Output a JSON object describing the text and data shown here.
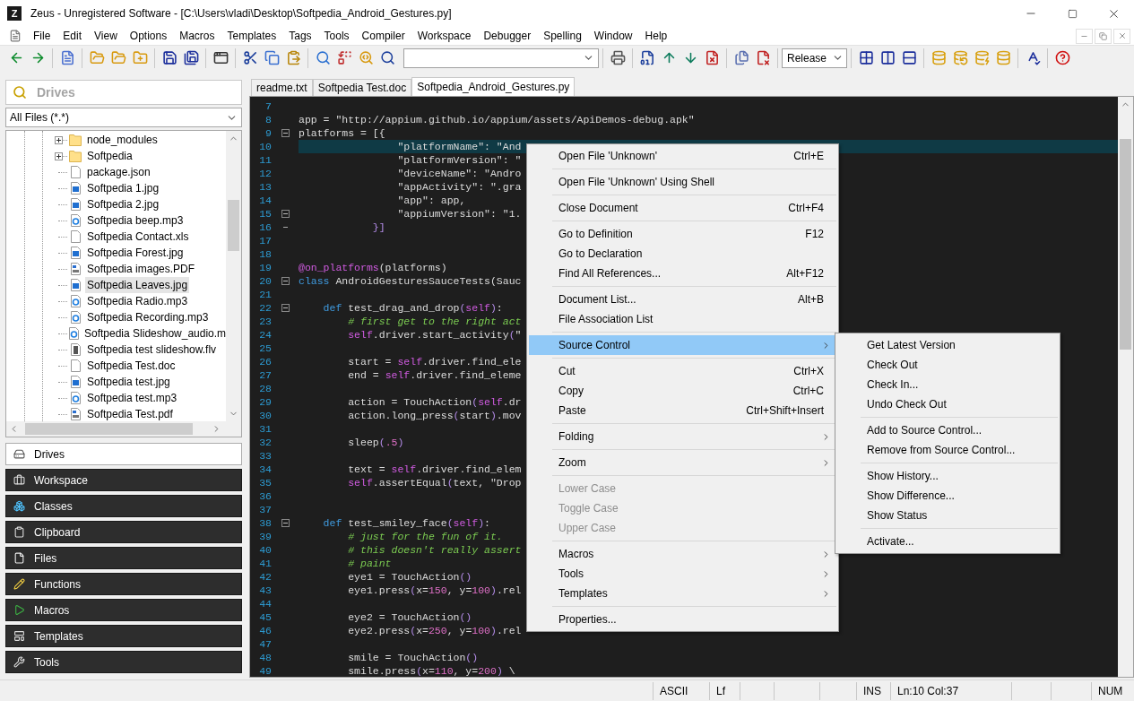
{
  "window": {
    "app_icon_letter": "Z",
    "title": "Zeus - Unregistered Software - [C:\\Users\\vladi\\Desktop\\Softpedia_Android_Gestures.py]"
  },
  "menu_bar": [
    "File",
    "Edit",
    "View",
    "Options",
    "Macros",
    "Templates",
    "Tags",
    "Tools",
    "Compiler",
    "Workspace",
    "Debugger",
    "Spelling",
    "Window",
    "Help"
  ],
  "toolbar": {
    "configuration": "Release"
  },
  "side_panel": {
    "header": "Drives",
    "filter": "All Files (*.*)",
    "tree": [
      {
        "name": "node_modules",
        "kind": "folder",
        "expanded": false,
        "selected": false
      },
      {
        "name": "Softpedia",
        "kind": "folder",
        "expanded": false,
        "selected": false
      },
      {
        "name": "package.json",
        "kind": "file",
        "selected": false
      },
      {
        "name": "Softpedia 1.jpg",
        "kind": "image",
        "selected": false
      },
      {
        "name": "Softpedia 2.jpg",
        "kind": "image",
        "selected": false
      },
      {
        "name": "Softpedia beep.mp3",
        "kind": "audio",
        "selected": false
      },
      {
        "name": "Softpedia Contact.xls",
        "kind": "file",
        "selected": false
      },
      {
        "name": "Softpedia Forest.jpg",
        "kind": "image",
        "selected": false
      },
      {
        "name": "Softpedia images.PDF",
        "kind": "pdf",
        "selected": false
      },
      {
        "name": "Softpedia Leaves.jpg",
        "kind": "image",
        "selected": true
      },
      {
        "name": "Softpedia Radio.mp3",
        "kind": "audio",
        "selected": false
      },
      {
        "name": "Softpedia Recording.mp3",
        "kind": "audio",
        "selected": false
      },
      {
        "name": "Softpedia Slideshow_audio.m",
        "kind": "audio",
        "selected": false
      },
      {
        "name": "Softpedia test slideshow.flv",
        "kind": "video",
        "selected": false
      },
      {
        "name": "Softpedia Test.doc",
        "kind": "file",
        "selected": false
      },
      {
        "name": "Softpedia test.jpg",
        "kind": "image",
        "selected": false
      },
      {
        "name": "Softpedia test.mp3",
        "kind": "audio",
        "selected": false
      },
      {
        "name": "Softpedia Test.pdf",
        "kind": "pdf",
        "selected": false
      }
    ],
    "panels": [
      {
        "label": "Drives",
        "kind": "drives",
        "selected": true
      },
      {
        "label": "Workspace",
        "kind": "workspace",
        "selected": false
      },
      {
        "label": "Classes",
        "kind": "classes",
        "selected": false
      },
      {
        "label": "Clipboard",
        "kind": "clipboard",
        "selected": false
      },
      {
        "label": "Files",
        "kind": "files",
        "selected": false
      },
      {
        "label": "Functions",
        "kind": "functions",
        "selected": false
      },
      {
        "label": "Macros",
        "kind": "macros",
        "selected": false
      },
      {
        "label": "Templates",
        "kind": "templates",
        "selected": false
      },
      {
        "label": "Tools",
        "kind": "tools",
        "selected": false
      }
    ]
  },
  "editor": {
    "tabs": [
      {
        "label": "readme.txt",
        "selected": false
      },
      {
        "label": "Softpedia Test.doc",
        "selected": false
      },
      {
        "label": "Softpedia_Android_Gestures.py",
        "selected": true
      }
    ],
    "lines": [
      {
        "number": "7",
        "current": false
      },
      {
        "number": "8",
        "current": false,
        "tokens": [
          {
            "kind": "plain",
            "text": "app = \"http://appium.github.io/appium/assets/ApiDemos-debug.apk\""
          }
        ]
      },
      {
        "number": "9",
        "current": false,
        "fold": {
          "kind": "start"
        },
        "tokens": [
          {
            "kind": "plain",
            "text": "platforms = [{"
          }
        ]
      },
      {
        "number": "10",
        "current": true,
        "tokens": [
          {
            "kind": "plain",
            "text": "                \"platformName\": \"And"
          }
        ]
      },
      {
        "number": "11",
        "current": false,
        "tokens": [
          {
            "kind": "plain",
            "text": "                \"platformVersion\": \""
          }
        ]
      },
      {
        "number": "12",
        "current": false,
        "tokens": [
          {
            "kind": "plain",
            "text": "                \"deviceName\": \"Andro"
          }
        ]
      },
      {
        "number": "13",
        "current": false,
        "tokens": [
          {
            "kind": "plain",
            "text": "                \"appActivity\": \".gra"
          }
        ]
      },
      {
        "number": "14",
        "current": false,
        "tokens": [
          {
            "kind": "plain",
            "text": "                \"app\": app,"
          }
        ]
      },
      {
        "number": "15",
        "current": false,
        "fold": {
          "kind": "start"
        },
        "tokens": [
          {
            "kind": "plain",
            "text": "                \"appiumVersion\": \"1."
          }
        ]
      },
      {
        "number": "16",
        "current": false,
        "fold": {
          "kind": "end"
        },
        "tokens": [
          {
            "kind": "paren",
            "text": "            }]"
          }
        ]
      },
      {
        "number": "17",
        "current": false
      },
      {
        "number": "18",
        "current": false
      },
      {
        "number": "19",
        "current": false,
        "tokens": [
          {
            "kind": "deco",
            "text": "@on_platforms"
          },
          {
            "kind": "plain",
            "text": "(platforms)"
          }
        ]
      },
      {
        "number": "20",
        "current": false,
        "fold": {
          "kind": "start"
        },
        "tokens": [
          {
            "kind": "kw",
            "text": "class"
          },
          {
            "kind": "plain",
            "text": " AndroidGesturesSauceTests(Sauc"
          }
        ]
      },
      {
        "number": "21",
        "current": false
      },
      {
        "number": "22",
        "current": false,
        "fold": {
          "kind": "start"
        },
        "tokens": [
          {
            "kind": "kw",
            "text": "    def"
          },
          {
            "kind": "plain",
            "text": " test_drag_and_drop"
          },
          {
            "kind": "paren",
            "text": "("
          },
          {
            "kind": "self",
            "text": "self"
          },
          {
            "kind": "paren",
            "text": ")"
          },
          {
            "kind": "plain",
            "text": ":"
          }
        ]
      },
      {
        "number": "23",
        "current": false,
        "tokens": [
          {
            "kind": "comment",
            "text": "        # first get to the right act"
          }
        ]
      },
      {
        "number": "24",
        "current": false,
        "tokens": [
          {
            "kind": "self",
            "text": "        self"
          },
          {
            "kind": "plain",
            "text": ".driver.start_activity"
          },
          {
            "kind": "paren",
            "text": "("
          },
          {
            "kind": "plain",
            "text": "\""
          }
        ]
      },
      {
        "number": "25",
        "current": false
      },
      {
        "number": "26",
        "current": false,
        "tokens": [
          {
            "kind": "plain",
            "text": "        start = "
          },
          {
            "kind": "self",
            "text": "self"
          },
          {
            "kind": "plain",
            "text": ".driver.find_ele"
          }
        ]
      },
      {
        "number": "27",
        "current": false,
        "tokens": [
          {
            "kind": "plain",
            "text": "        end = "
          },
          {
            "kind": "self",
            "text": "self"
          },
          {
            "kind": "plain",
            "text": ".driver.find_eleme"
          }
        ]
      },
      {
        "number": "28",
        "current": false
      },
      {
        "number": "29",
        "current": false,
        "tokens": [
          {
            "kind": "plain",
            "text": "        action = TouchAction"
          },
          {
            "kind": "paren",
            "text": "("
          },
          {
            "kind": "self",
            "text": "self"
          },
          {
            "kind": "plain",
            "text": ".dr"
          }
        ]
      },
      {
        "number": "30",
        "current": false,
        "tokens": [
          {
            "kind": "plain",
            "text": "        action.long_press"
          },
          {
            "kind": "paren",
            "text": "("
          },
          {
            "kind": "plain",
            "text": "start"
          },
          {
            "kind": "paren",
            "text": ")"
          },
          {
            "kind": "plain",
            "text": ".mov"
          }
        ]
      },
      {
        "number": "31",
        "current": false
      },
      {
        "number": "32",
        "current": false,
        "tokens": [
          {
            "kind": "plain",
            "text": "        sleep"
          },
          {
            "kind": "paren",
            "text": "("
          },
          {
            "kind": "num",
            "text": ".5"
          },
          {
            "kind": "paren",
            "text": ")"
          }
        ]
      },
      {
        "number": "33",
        "current": false
      },
      {
        "number": "34",
        "current": false,
        "tokens": [
          {
            "kind": "plain",
            "text": "        text = "
          },
          {
            "kind": "self",
            "text": "self"
          },
          {
            "kind": "plain",
            "text": ".driver.find_elem"
          }
        ]
      },
      {
        "number": "35",
        "current": false,
        "tokens": [
          {
            "kind": "self",
            "text": "        self"
          },
          {
            "kind": "plain",
            "text": ".assertEqual"
          },
          {
            "kind": "paren",
            "text": "("
          },
          {
            "kind": "plain",
            "text": "text, \"Drop"
          }
        ]
      },
      {
        "number": "36",
        "current": false
      },
      {
        "number": "37",
        "current": false
      },
      {
        "number": "38",
        "current": false,
        "fold": {
          "kind": "start"
        },
        "tokens": [
          {
            "kind": "kw",
            "text": "    def"
          },
          {
            "kind": "plain",
            "text": " test_smiley_face"
          },
          {
            "kind": "paren",
            "text": "("
          },
          {
            "kind": "self",
            "text": "self"
          },
          {
            "kind": "paren",
            "text": ")"
          },
          {
            "kind": "plain",
            "text": ":"
          }
        ]
      },
      {
        "number": "39",
        "current": false,
        "tokens": [
          {
            "kind": "comment",
            "text": "        # just for the fun of it."
          }
        ]
      },
      {
        "number": "40",
        "current": false,
        "tokens": [
          {
            "kind": "comment",
            "text": "        # this doesn't really assert"
          }
        ]
      },
      {
        "number": "41",
        "current": false,
        "tokens": [
          {
            "kind": "comment",
            "text": "        # paint"
          }
        ]
      },
      {
        "number": "42",
        "current": false,
        "tokens": [
          {
            "kind": "plain",
            "text": "        eye1 = TouchAction"
          },
          {
            "kind": "paren",
            "text": "()"
          }
        ]
      },
      {
        "number": "43",
        "current": false,
        "tokens": [
          {
            "kind": "plain",
            "text": "        eye1.press"
          },
          {
            "kind": "paren",
            "text": "("
          },
          {
            "kind": "plain",
            "text": "x="
          },
          {
            "kind": "num",
            "text": "150"
          },
          {
            "kind": "plain",
            "text": ", y="
          },
          {
            "kind": "num",
            "text": "100"
          },
          {
            "kind": "paren",
            "text": ")"
          },
          {
            "kind": "plain",
            "text": ".rel"
          }
        ]
      },
      {
        "number": "44",
        "current": false
      },
      {
        "number": "45",
        "current": false,
        "tokens": [
          {
            "kind": "plain",
            "text": "        eye2 = TouchAction"
          },
          {
            "kind": "paren",
            "text": "()"
          }
        ]
      },
      {
        "number": "46",
        "current": false,
        "tokens": [
          {
            "kind": "plain",
            "text": "        eye2.press"
          },
          {
            "kind": "paren",
            "text": "("
          },
          {
            "kind": "plain",
            "text": "x="
          },
          {
            "kind": "num",
            "text": "250"
          },
          {
            "kind": "plain",
            "text": ", y="
          },
          {
            "kind": "num",
            "text": "100"
          },
          {
            "kind": "paren",
            "text": ")"
          },
          {
            "kind": "plain",
            "text": ".rel"
          }
        ]
      },
      {
        "number": "47",
        "current": false
      },
      {
        "number": "48",
        "current": false,
        "tokens": [
          {
            "kind": "plain",
            "text": "        smile = TouchAction"
          },
          {
            "kind": "paren",
            "text": "()"
          }
        ]
      },
      {
        "number": "49",
        "current": false,
        "tokens": [
          {
            "kind": "plain",
            "text": "        smile.press"
          },
          {
            "kind": "paren",
            "text": "("
          },
          {
            "kind": "plain",
            "text": "x="
          },
          {
            "kind": "num",
            "text": "110"
          },
          {
            "kind": "plain",
            "text": ", y="
          },
          {
            "kind": "num",
            "text": "200"
          },
          {
            "kind": "paren",
            "text": ")"
          },
          {
            "kind": "plain",
            "text": " \\"
          }
        ]
      }
    ]
  },
  "context_menu": {
    "items": [
      {
        "kind": "item",
        "label": "Open File 'Unknown'",
        "shortcut": "Ctrl+E",
        "submenu": false,
        "disabled": false,
        "selected": false
      },
      {
        "kind": "separator"
      },
      {
        "kind": "item",
        "label": "Open File 'Unknown' Using Shell",
        "submenu": false,
        "disabled": false,
        "selected": false
      },
      {
        "kind": "separator"
      },
      {
        "kind": "item",
        "label": "Close Document",
        "shortcut": "Ctrl+F4",
        "submenu": false,
        "disabled": false,
        "selected": false
      },
      {
        "kind": "separator"
      },
      {
        "kind": "item",
        "label": "Go to Definition",
        "shortcut": "F12",
        "submenu": false,
        "disabled": false,
        "selected": false
      },
      {
        "kind": "item",
        "label": "Go to Declaration",
        "submenu": false,
        "disabled": false,
        "selected": false
      },
      {
        "kind": "item",
        "label": "Find All References...",
        "shortcut": "Alt+F12",
        "submenu": false,
        "disabled": false,
        "selected": false
      },
      {
        "kind": "separator"
      },
      {
        "kind": "item",
        "label": "Document List...",
        "shortcut": "Alt+B",
        "submenu": false,
        "disabled": false,
        "selected": false
      },
      {
        "kind": "item",
        "label": "File Association List",
        "submenu": false,
        "disabled": false,
        "selected": false
      },
      {
        "kind": "separator"
      },
      {
        "kind": "item",
        "label": "Source Control",
        "submenu": true,
        "disabled": false,
        "selected": true
      },
      {
        "kind": "separator"
      },
      {
        "kind": "item",
        "label": "Cut",
        "shortcut": "Ctrl+X",
        "submenu": false,
        "disabled": false,
        "selected": false
      },
      {
        "kind": "item",
        "label": "Copy",
        "shortcut": "Ctrl+C",
        "submenu": false,
        "disabled": false,
        "selected": false
      },
      {
        "kind": "item",
        "label": "Paste",
        "shortcut": "Ctrl+Shift+Insert",
        "submenu": false,
        "disabled": false,
        "selected": false
      },
      {
        "kind": "separator"
      },
      {
        "kind": "item",
        "label": "Folding",
        "submenu": true,
        "disabled": false,
        "selected": false
      },
      {
        "kind": "separator"
      },
      {
        "kind": "item",
        "label": "Zoom",
        "submenu": true,
        "disabled": false,
        "selected": false
      },
      {
        "kind": "separator"
      },
      {
        "kind": "item",
        "label": "Lower Case",
        "submenu": false,
        "disabled": true,
        "selected": false
      },
      {
        "kind": "item",
        "label": "Toggle Case",
        "submenu": false,
        "disabled": true,
        "selected": false
      },
      {
        "kind": "item",
        "label": "Upper Case",
        "submenu": false,
        "disabled": true,
        "selected": false
      },
      {
        "kind": "separator"
      },
      {
        "kind": "item",
        "label": "Macros",
        "submenu": true,
        "disabled": false,
        "selected": false
      },
      {
        "kind": "item",
        "label": "Tools",
        "submenu": true,
        "disabled": false,
        "selected": false
      },
      {
        "kind": "item",
        "label": "Templates",
        "submenu": true,
        "disabled": false,
        "selected": false
      },
      {
        "kind": "separator"
      },
      {
        "kind": "item",
        "label": "Properties...",
        "submenu": false,
        "disabled": false,
        "selected": false
      }
    ]
  },
  "submenu": {
    "items": [
      {
        "kind": "item",
        "label": "Get Latest Version"
      },
      {
        "kind": "item",
        "label": "Check Out"
      },
      {
        "kind": "item",
        "label": "Check In..."
      },
      {
        "kind": "item",
        "label": "Undo Check Out"
      },
      {
        "kind": "separator"
      },
      {
        "kind": "item",
        "label": "Add to Source Control..."
      },
      {
        "kind": "item",
        "label": "Remove from Source Control..."
      },
      {
        "kind": "separator"
      },
      {
        "kind": "item",
        "label": "Show History..."
      },
      {
        "kind": "item",
        "label": "Show Difference..."
      },
      {
        "kind": "item",
        "label": "Show Status"
      },
      {
        "kind": "separator"
      },
      {
        "kind": "item",
        "label": "Activate..."
      }
    ]
  },
  "status_bar": {
    "encoding": "ASCII",
    "line_ending": "Lf",
    "mode": "INS",
    "position": "Ln:10 Col:37",
    "num_lock": "NUM"
  }
}
